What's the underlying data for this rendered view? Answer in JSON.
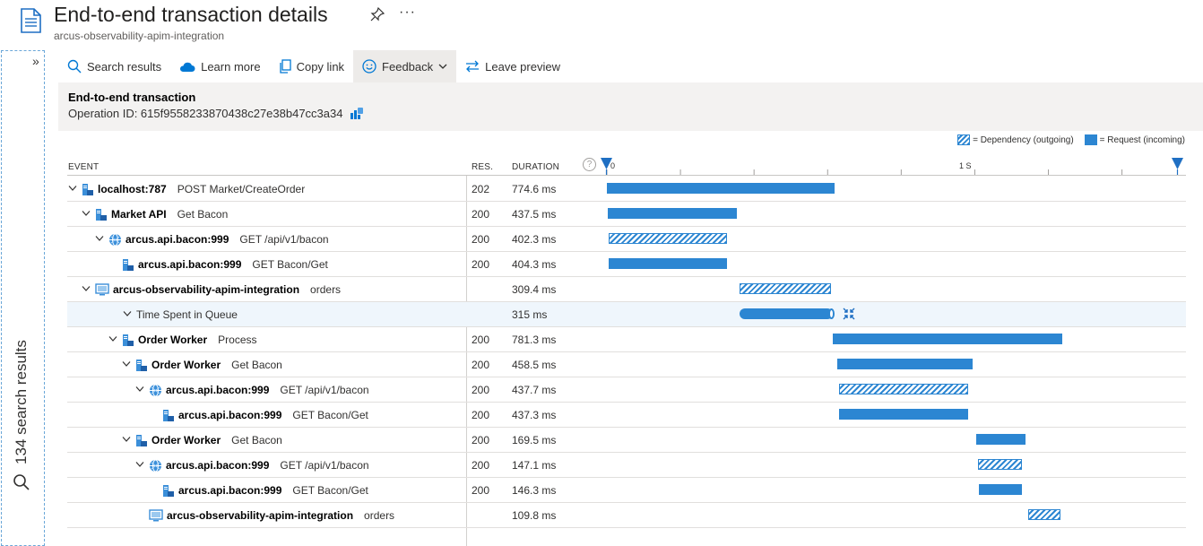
{
  "header": {
    "title": "End-to-end transaction details",
    "subtitle": "arcus-observability-apim-integration",
    "more": "···"
  },
  "left_pane": {
    "chevron": "»",
    "label": "134 search results"
  },
  "toolbar": {
    "search_results": "Search results",
    "learn_more": "Learn more",
    "copy_link": "Copy link",
    "feedback": "Feedback",
    "leave_preview": "Leave preview"
  },
  "transaction": {
    "title": "End-to-end transaction",
    "operation_id": "Operation ID: 615f9558233870438c27e38b47cc3a34"
  },
  "legend": {
    "dependency": "= Dependency (outgoing)",
    "request": "= Request (incoming)"
  },
  "columns": {
    "event": "EVENT",
    "res": "RES.",
    "duration": "DURATION",
    "help": "?"
  },
  "timeline": {
    "tick_start": "0",
    "tick_mid": "1 S",
    "total_seconds": 1.94
  },
  "colors": {
    "accent": "#2c86d2",
    "selected_row": "#eff6fc"
  },
  "rows": [
    {
      "depth": 0,
      "chevron": "v",
      "icon": "server-icon",
      "name": "localhost:787",
      "op": "POST Market/CreateOrder",
      "res": "202",
      "duration": "774.6 ms",
      "bar": "request",
      "start": 0.0,
      "len": 0.7746
    },
    {
      "depth": 1,
      "chevron": "v",
      "icon": "server-icon",
      "name": "Market API",
      "op": "Get Bacon",
      "res": "200",
      "duration": "437.5 ms",
      "bar": "request",
      "start": 0.003,
      "len": 0.4375
    },
    {
      "depth": 2,
      "chevron": "v",
      "icon": "globe-icon",
      "name": "arcus.api.bacon:999",
      "op": "GET /api/v1/bacon",
      "res": "200",
      "duration": "402.3 ms",
      "bar": "dependency",
      "start": 0.005,
      "len": 0.4023
    },
    {
      "depth": 3,
      "chevron": "",
      "icon": "server-icon",
      "name": "arcus.api.bacon:999",
      "op": "GET Bacon/Get",
      "res": "200",
      "duration": "404.3 ms",
      "bar": "request",
      "start": 0.005,
      "len": 0.4043
    },
    {
      "depth": 1,
      "chevron": "v",
      "icon": "monitor-icon",
      "name": "arcus-observability-apim-integration",
      "op": "orders",
      "res": "",
      "duration": "309.4 ms",
      "bar": "dependency",
      "start": 0.452,
      "len": 0.3094
    },
    {
      "depth": 2,
      "chevron": "v",
      "icon": "",
      "name": "Time Spent in Queue",
      "op": "",
      "res": "",
      "duration": "315 ms",
      "bar": "queue",
      "start": 0.452,
      "len": 0.315,
      "selected": true,
      "plain": true
    },
    {
      "depth": 3,
      "chevron": "v",
      "icon": "server-icon",
      "name": "Order Worker",
      "op": "Process",
      "res": "200",
      "duration": "781.3 ms",
      "bar": "request",
      "start": 0.767,
      "len": 0.7813
    },
    {
      "depth": 4,
      "chevron": "v",
      "icon": "server-icon",
      "name": "Order Worker",
      "op": "Get Bacon",
      "res": "200",
      "duration": "458.5 ms",
      "bar": "request",
      "start": 0.783,
      "len": 0.4585
    },
    {
      "depth": 5,
      "chevron": "v",
      "icon": "globe-icon",
      "name": "arcus.api.bacon:999",
      "op": "GET /api/v1/bacon",
      "res": "200",
      "duration": "437.7 ms",
      "bar": "dependency",
      "start": 0.79,
      "len": 0.4377
    },
    {
      "depth": 6,
      "chevron": "",
      "icon": "server-icon",
      "name": "arcus.api.bacon:999",
      "op": "GET Bacon/Get",
      "res": "200",
      "duration": "437.3 ms",
      "bar": "request",
      "start": 0.79,
      "len": 0.4373
    },
    {
      "depth": 4,
      "chevron": "v",
      "icon": "server-icon",
      "name": "Order Worker",
      "op": "Get Bacon",
      "res": "200",
      "duration": "169.5 ms",
      "bar": "request",
      "start": 1.254,
      "len": 0.1695
    },
    {
      "depth": 5,
      "chevron": "v",
      "icon": "globe-icon",
      "name": "arcus.api.bacon:999",
      "op": "GET /api/v1/bacon",
      "res": "200",
      "duration": "147.1 ms",
      "bar": "dependency",
      "start": 1.262,
      "len": 0.1471
    },
    {
      "depth": 6,
      "chevron": "",
      "icon": "server-icon",
      "name": "arcus.api.bacon:999",
      "op": "GET Bacon/Get",
      "res": "200",
      "duration": "146.3 ms",
      "bar": "request",
      "start": 1.263,
      "len": 0.1463
    },
    {
      "depth": 5,
      "chevron": "",
      "icon": "monitor-icon",
      "name": "arcus-observability-apim-integration",
      "op": "orders",
      "res": "",
      "duration": "109.8 ms",
      "bar": "dependency",
      "start": 1.43,
      "len": 0.1098
    }
  ]
}
